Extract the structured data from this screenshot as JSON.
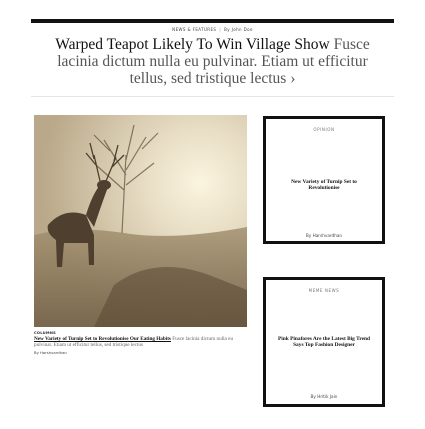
{
  "meta": {
    "section": "NEWS & FEATURES",
    "author": "By  John Doe"
  },
  "headline": {
    "title": "Warped Teapot Likely To Win Village Show",
    "dek": "Fusce lacinia dictum nulla eu pulvinar. Etiam ut efficitur tellus, sed tristique lectus",
    "arrow": "›"
  },
  "hero": {
    "kicker": "COLUMNS",
    "title": "New Variety of Turnip Set to Revolutionise Our Eating Habits",
    "dek": "Fusce lacinia dictum nulla eu pulvinar. Etiam ut efficitur tellus, sed tristique lectus",
    "byline": "By  Harshvardhan"
  },
  "cards": [
    {
      "label": "OPINION",
      "title": "New Variety of Turnip Set to Revolutionise",
      "byline": "By  Harshvardhan"
    },
    {
      "label": "MEME NEWS",
      "title": "Pink Pinafores Are the Latest Big Trend Says Top Fashion Designer",
      "byline": "By  Hritik Jain"
    }
  ]
}
